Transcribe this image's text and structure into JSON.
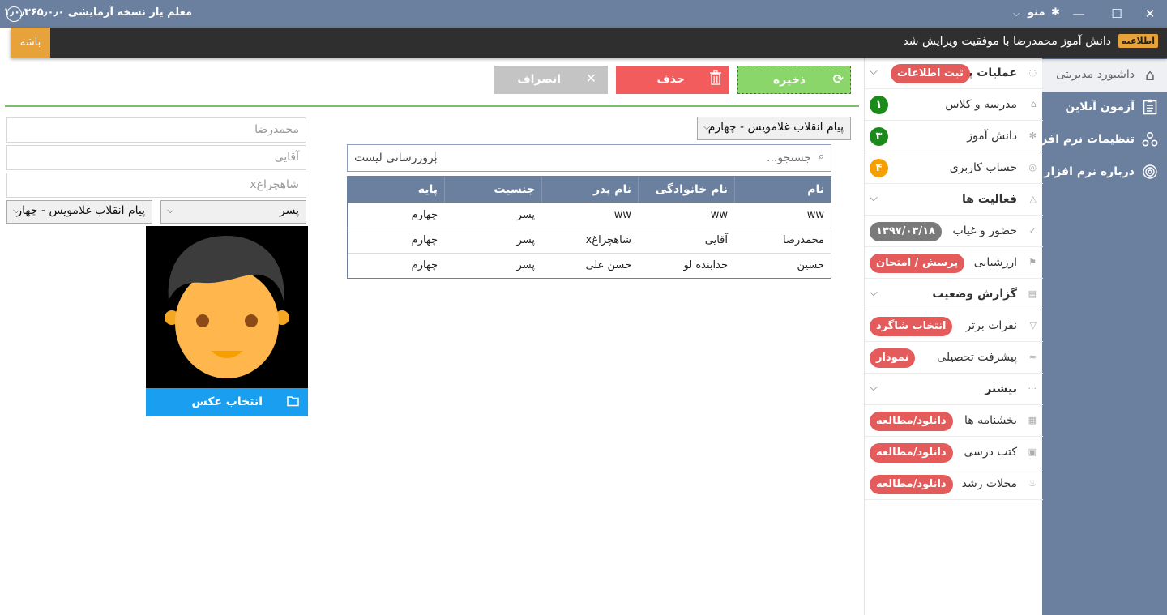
{
  "titlebar": {
    "title": "معلم یار نسخه آزمایشی ۱٫۰٫۳۶۵٫۰٫۰",
    "menu_label": "منو",
    "minimize": "—",
    "maximize": "☐",
    "close": "✕"
  },
  "notification": {
    "badge": "اطلاعیه",
    "message": "دانش آموز محمدرضا با موفقیت ویرایش شد",
    "ok_label": "باشه"
  },
  "sidebar": {
    "items": [
      {
        "label": "داشبورد مدیریتی",
        "icon": "home-icon",
        "glyph": "⌂"
      },
      {
        "label": "آزمون آنلاین",
        "icon": "clipboard-icon",
        "glyph": "📋"
      },
      {
        "label": "تنظیمات نرم افزار",
        "icon": "settings-icon",
        "glyph": "⚙"
      },
      {
        "label": "درباره نرم افزار",
        "icon": "fingerprint-icon",
        "glyph": "◎"
      }
    ]
  },
  "menu": {
    "base_ops": {
      "label": "عملیات پایه",
      "pill": "ثبت اطلاعات"
    },
    "school_class": {
      "label": "مدرسه و کلاس",
      "count": "۱"
    },
    "student": {
      "label": "دانش آموز",
      "count": "۳"
    },
    "account": {
      "label": "حساب کاربری",
      "count": "۴"
    },
    "activities": {
      "label": "فعالیت ها"
    },
    "attendance": {
      "label": "حضور و غیاب",
      "pill": "۱۳۹۷/۰۳/۱۸"
    },
    "evaluation": {
      "label": "ارزشیابی",
      "pill": "پرسش / امتحان"
    },
    "report": {
      "label": "گزارش وضعیت"
    },
    "top_students": {
      "label": "نفرات برتر",
      "pill": "انتخاب شاگرد"
    },
    "progress": {
      "label": "پیشرفت تحصیلی",
      "pill": "نمودار"
    },
    "more": {
      "label": "بیشتر"
    },
    "circulars": {
      "label": "بخشنامه ها",
      "pill": "دانلود/مطالعه"
    },
    "textbooks": {
      "label": "کتب درسی",
      "pill": "دانلود/مطالعه"
    },
    "magazines": {
      "label": "مجلات رشد",
      "pill": "دانلود/مطالعه"
    }
  },
  "toolbar": {
    "save_label": "ذخیره",
    "delete_label": "حذف",
    "cancel_label": "انصراف"
  },
  "form": {
    "first_name": "محمدرضا",
    "last_name": "آقایی",
    "father_name": "شاهچراغx",
    "gender": "پسر",
    "class": "پیام انقلاب غلامویس - چهار",
    "photo_button": "انتخاب عکس"
  },
  "list": {
    "class_filter": "پیام انقلاب غلامویس - چهارم",
    "search_placeholder": "جستجو...",
    "refresh_label": "بروزرسانی لیست",
    "columns": [
      "نام",
      "نام خانوادگی",
      "نام پدر",
      "جنسیت",
      "پایه"
    ],
    "rows": [
      [
        "ww",
        "ww",
        "ww",
        "پسر",
        "چهارم"
      ],
      [
        "محمدرضا",
        "آقایی",
        "شاهچراغx",
        "پسر",
        "چهارم"
      ],
      [
        "حسین",
        "خدابنده لو",
        "حسن علی",
        "پسر",
        "چهارم"
      ]
    ]
  },
  "colors": {
    "titlebar": "#6b7f9e",
    "accent_orange": "#e8a23a",
    "save_green": "#8ad66b",
    "delete_red": "#f25c5c",
    "pill_red": "#e45b5b",
    "photo_blue": "#1a9ff0",
    "count_green": "#1a8a1a",
    "count_orange": "#f5a000"
  }
}
